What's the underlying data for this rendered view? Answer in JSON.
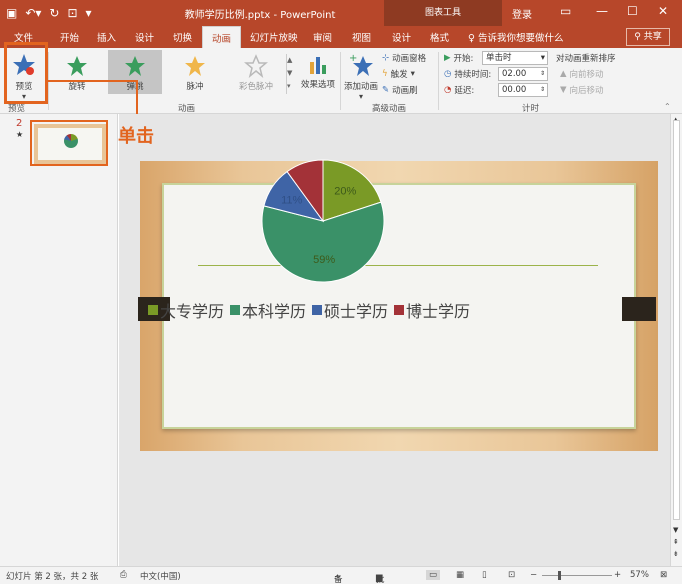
{
  "title_bar": {
    "document_title": "教师学历比例.pptx - PowerPoint",
    "contextual_tools": "图表工具",
    "login": "登录"
  },
  "tabs": [
    "文件",
    "开始",
    "插入",
    "设计",
    "切换",
    "动画",
    "幻灯片放映",
    "审阅",
    "视图",
    "设计",
    "格式"
  ],
  "active_tab": "动画",
  "tell_me": "告诉我你想要做什么",
  "share": "共享",
  "ribbon": {
    "preview_label": "预览",
    "preview_group": "预览",
    "animations_group": "动画",
    "effects": [
      "旋转",
      "弹跳",
      "脉冲",
      "彩色脉冲"
    ],
    "effect_options": "效果选项",
    "add_animation": "添加动画",
    "animation_pane": "动画窗格",
    "trigger": "触发",
    "animation_painter": "动画刷",
    "advanced_group": "高级动画",
    "start_label": "开始:",
    "start_value": "单击时",
    "duration_label": "持续时间:",
    "duration_value": "02.00",
    "delay_label": "延迟:",
    "delay_value": "00.00",
    "reorder_title": "对动画重新排序",
    "move_earlier": "向前移动",
    "move_later": "向后移动",
    "timing_group": "计时"
  },
  "annotation": "单击",
  "slide_panel": {
    "slide_number": "2",
    "star": "★"
  },
  "chart_data": {
    "type": "pie",
    "categories": [
      "大专学历",
      "本科学历",
      "硕士学历",
      "博士学历"
    ],
    "values": [
      20,
      59,
      11,
      10
    ],
    "labels": [
      "20%",
      "59%",
      "11%",
      ""
    ],
    "colors": [
      "#7a9a26",
      "#3a9168",
      "#3f64a6",
      "#a33238"
    ]
  },
  "status": {
    "slide_info": "幻灯片 第 2 张，共 2 张",
    "language": "中文(中国)",
    "notes": "备注",
    "comments": "批注",
    "zoom": "57%"
  }
}
